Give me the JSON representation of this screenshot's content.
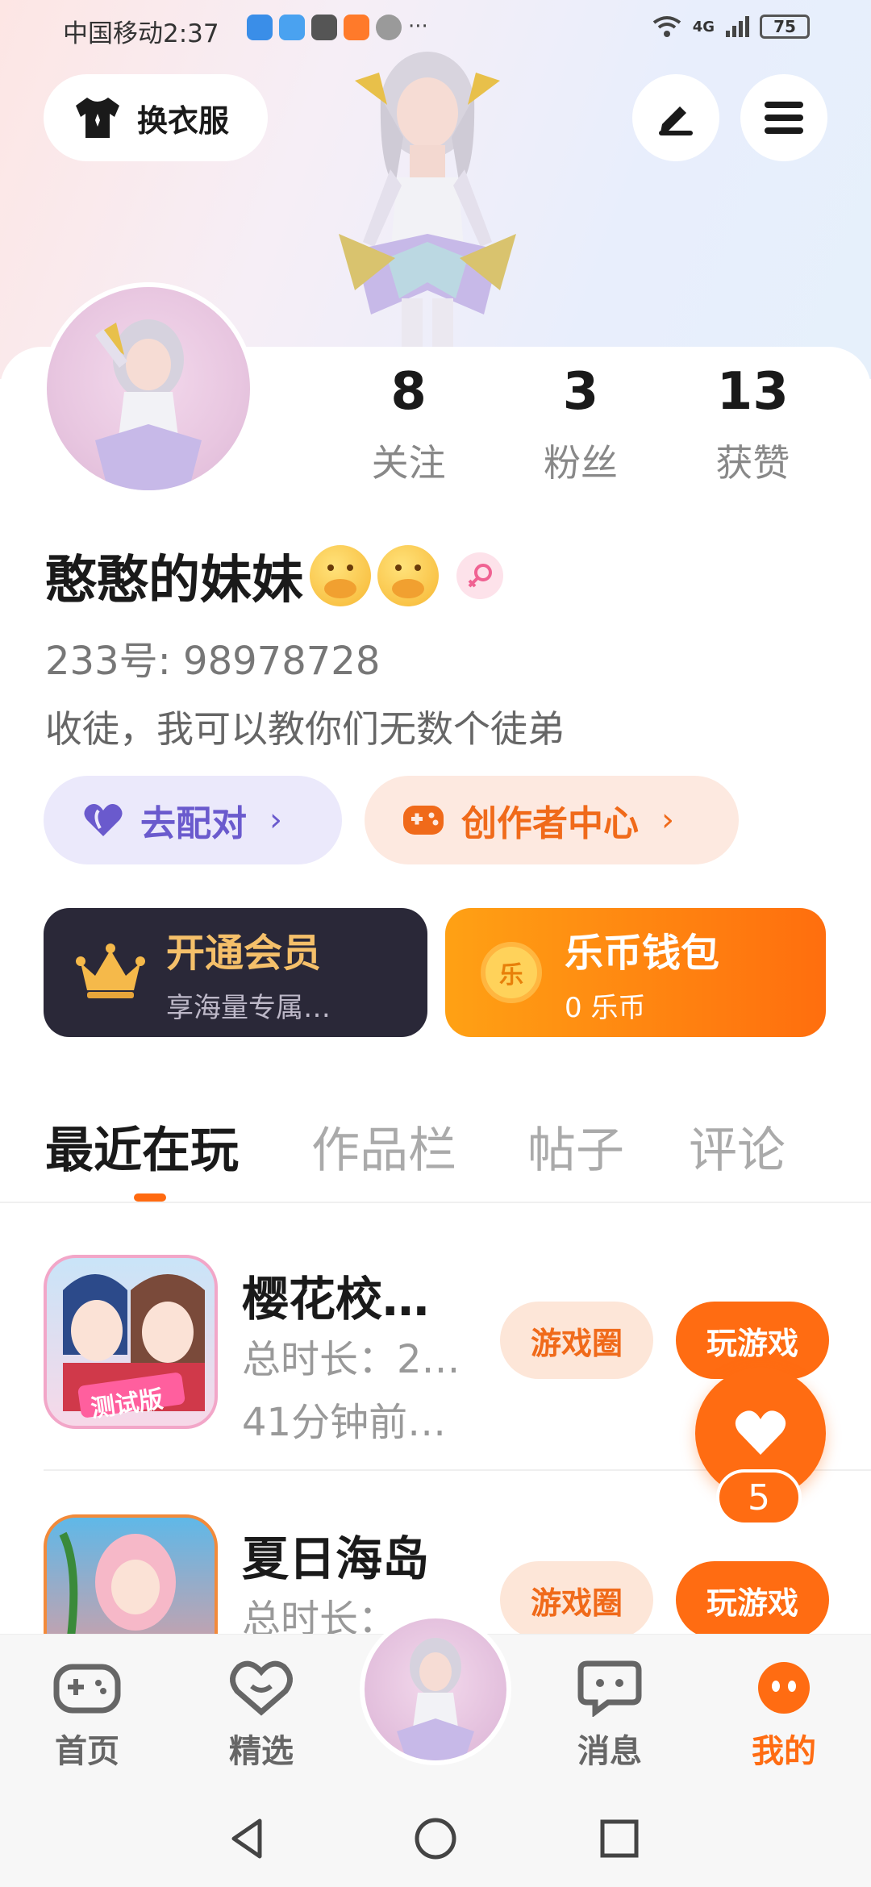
{
  "status_bar": {
    "carrier": "中国移动",
    "time": "2:37",
    "dots": "···",
    "network": "4G",
    "battery": "75"
  },
  "header": {
    "change_outfit_label": "换衣服"
  },
  "profile": {
    "stats": [
      {
        "num": "8",
        "label": "关注"
      },
      {
        "num": "3",
        "label": "粉丝"
      },
      {
        "num": "13",
        "label": "获赞"
      }
    ],
    "username": "憨憨的妹妹",
    "uid": "233号:  98978728",
    "bio": "收徒，我可以教你们无数个徒弟"
  },
  "chips": {
    "match_label": "去配对",
    "creator_label": "创作者中心",
    "arrow": "›"
  },
  "promos": {
    "vip_title": "开通会员",
    "vip_sub": "享海量专属…",
    "coin_title": "乐币钱包",
    "coin_sub": "0 乐币",
    "coin_glyph": "乐"
  },
  "tabs": [
    "最近在玩",
    "作品栏",
    "帖子",
    "评论"
  ],
  "games": [
    {
      "name": "樱花校…",
      "duration": "总时长：2…",
      "last_played": "41分钟前…",
      "badge": "测试版",
      "circle_label": "游戏圈",
      "play_label": "玩游戏"
    },
    {
      "name": "夏日海岛",
      "duration": "总时长：",
      "circle_label": "游戏圈",
      "play_label": "玩游戏"
    }
  ],
  "like_fab": {
    "count": "5"
  },
  "bottom_nav": [
    {
      "label": "首页"
    },
    {
      "label": "精选"
    },
    {
      "label": "消息"
    },
    {
      "label": "我的"
    }
  ],
  "colors": {
    "accent": "#ff6c12",
    "match": "#6a5acd",
    "vip_bg": "#2a2838",
    "vip_text": "#f5c06a"
  }
}
